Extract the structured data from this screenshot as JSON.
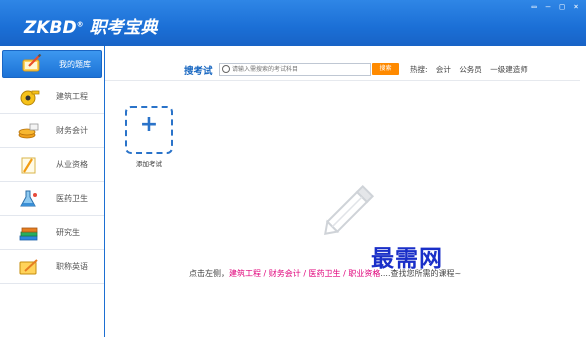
{
  "app": {
    "logo_text": "ZKBD",
    "logo_mark": "®",
    "logo_name": "职考宝典",
    "window_controls": [
      "▭",
      "–",
      "□",
      "×"
    ]
  },
  "sidebar": {
    "items": [
      {
        "label": "我的题库",
        "icon": "notebook-pencil-icon"
      },
      {
        "label": "建筑工程",
        "icon": "measuring-tape-icon"
      },
      {
        "label": "财务会计",
        "icon": "coins-stack-icon"
      },
      {
        "label": "从业资格",
        "icon": "certificate-pencil-icon"
      },
      {
        "label": "医药卫生",
        "icon": "flask-icon"
      },
      {
        "label": "研究生",
        "icon": "books-icon"
      },
      {
        "label": "职称英语",
        "icon": "english-pencil-icon"
      }
    ]
  },
  "search": {
    "title": "搜考试",
    "placeholder": "请输入需搜索的考试科目",
    "button_label": "搜索",
    "hot_label": "热搜:",
    "hot_items": [
      "会计",
      "公务员",
      "一级建造师"
    ]
  },
  "main": {
    "add_exam_label": "添加考试",
    "hint_prefix": "点击左侧，",
    "hint_links": "建筑工程 / 财务会计 / 医药卫生 / 职业资格",
    "hint_suffix": "....查找您所需的课程~"
  },
  "watermark": "最需网",
  "colors": {
    "titlebar": "#1b6fd6",
    "accent": "#2a73c9",
    "search_button": "#ff8a00",
    "link_red": "#e0007a",
    "watermark": "#1a2fc8"
  }
}
